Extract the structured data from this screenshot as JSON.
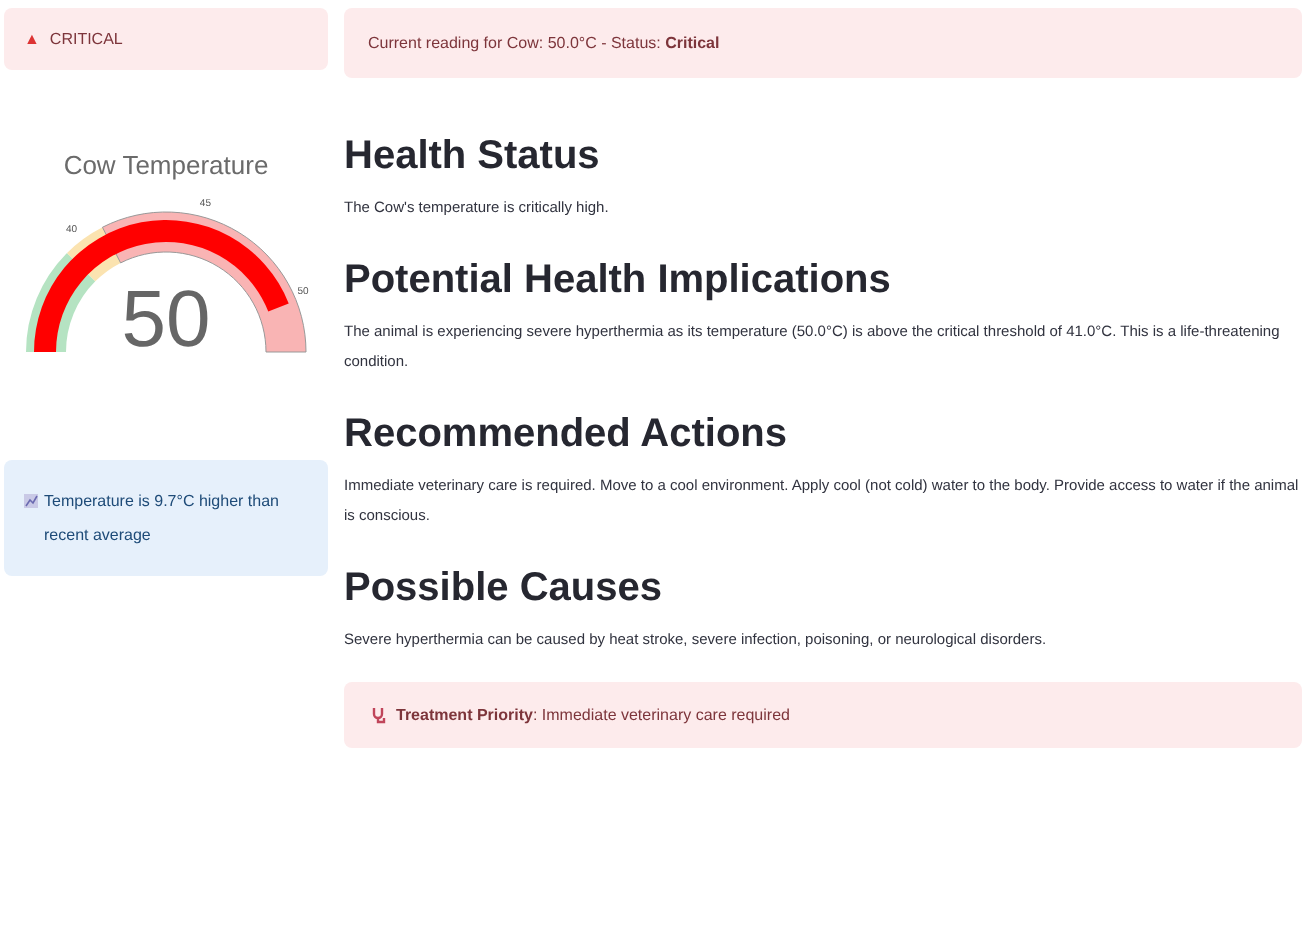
{
  "alert_badge": {
    "icon": "▲",
    "label": "CRITICAL"
  },
  "status_banner": {
    "text": "Current reading for Cow: 50.0°C - Status: **Critical**"
  },
  "gauge": {
    "title": "Cow Temperature",
    "value": "50",
    "level": 0.88,
    "ticks": [
      "40",
      "45",
      "50"
    ]
  },
  "trend_note": {
    "text": "Temperature is 9.7°C higher than recent average"
  },
  "sections": [
    {
      "heading": "Health Status",
      "body": "The Cow's temperature is critically high."
    },
    {
      "heading": "Potential Health Implications",
      "body": "The animal is experiencing severe hyperthermia as its temperature (50.0°C) is above the critical threshold of 41.0°C. This is a life-threatening condition."
    },
    {
      "heading": "Recommended Actions",
      "body": "Immediate veterinary care is required. Move to a cool environment. Apply cool (not cold) water to the body. Provide access to water if the animal is conscious."
    },
    {
      "heading": "Possible Causes",
      "body": "Severe hyperthermia can be caused by heat stroke, severe infection, poisoning, or neurological disorders."
    }
  ],
  "priority_banner": {
    "text": "**Treatment Priority**: Immediate veterinary care required"
  }
}
